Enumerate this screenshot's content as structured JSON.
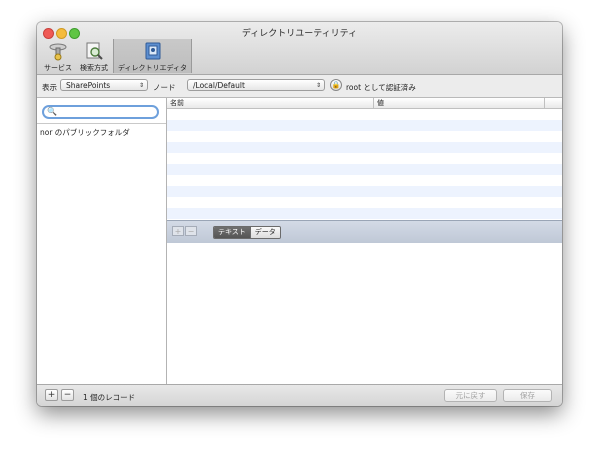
{
  "window": {
    "title": "ディレクトリユーティリティ"
  },
  "toolbar": {
    "items": [
      {
        "label": "サービス",
        "icon": "services-icon"
      },
      {
        "label": "検索方式",
        "icon": "search-policy-icon"
      },
      {
        "label": "ディレクトリエディタ",
        "icon": "directory-editor-icon",
        "selected": true
      }
    ]
  },
  "options": {
    "view_label": "表示",
    "view_value": "SharePoints",
    "node_label": "ノード",
    "node_value": "/Local/Default",
    "auth_status": "root として認証済み"
  },
  "left": {
    "search": {
      "value": "",
      "placeholder": ""
    },
    "records": [
      "nor のパブリックフォルダ"
    ]
  },
  "table": {
    "columns": [
      "名前",
      "値"
    ],
    "rows": []
  },
  "subbar": {
    "add_label": "+",
    "remove_label": "−",
    "modes": [
      "テキスト",
      "データ"
    ],
    "active_mode": "テキスト"
  },
  "bottom": {
    "add_label": "+",
    "remove_label": "−",
    "record_count": "1 個のレコード",
    "revert_label": "元に戻す",
    "save_label": "保存"
  },
  "colors": {
    "selection_blue": "#6ea0dc",
    "stripe": "#edf3fe",
    "subbar": "#c8d0dd"
  }
}
